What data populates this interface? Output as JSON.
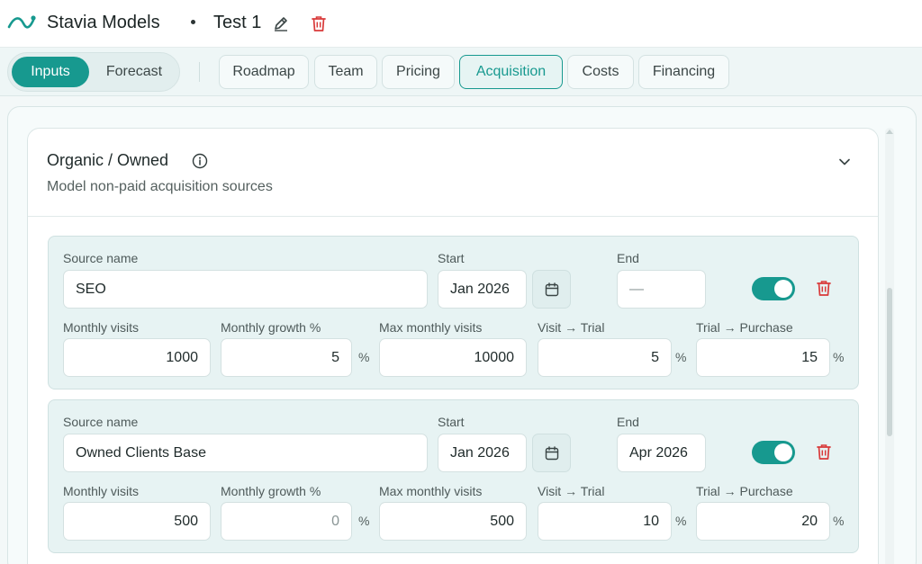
{
  "header": {
    "app_title": "Stavia Models",
    "model_name": "Test 1",
    "icons": [
      "logo-wave-icon",
      "pencil-icon",
      "trash-icon"
    ],
    "accent_color": "#17998f",
    "danger_color": "#d93a3a"
  },
  "mode_toggle": {
    "inputs": "Inputs",
    "forecast": "Forecast",
    "selected": "Inputs"
  },
  "tabs": {
    "roadmap": "Roadmap",
    "team": "Team",
    "pricing": "Pricing",
    "acquisition": "Acquisition",
    "costs": "Costs",
    "financing": "Financing",
    "active": "Acquisition"
  },
  "section": {
    "title": "Organic / Owned",
    "subtitle": "Model non-paid acquisition sources",
    "icons": [
      "info-icon",
      "chevron-down-icon"
    ]
  },
  "labels": {
    "source_name": "Source name",
    "start": "Start",
    "end": "End",
    "monthly_visits": "Monthly visits",
    "monthly_growth": "Monthly growth %",
    "max_monthly_visits": "Max monthly visits",
    "visit_trial": "Visit → Trial",
    "trial_purchase": "Trial → Purchase",
    "percent": "%"
  },
  "sources": [
    {
      "name": "SEO",
      "start": "Jan 2026",
      "end": "—",
      "enabled": true,
      "monthly_visits": "1000",
      "monthly_growth": "5",
      "max_monthly_visits": "10000",
      "visit_trial": "5",
      "trial_purchase": "15"
    },
    {
      "name": "Owned Clients Base",
      "start": "Jan 2026",
      "end": "Apr 2026",
      "enabled": true,
      "monthly_visits": "500",
      "monthly_growth": "0",
      "max_monthly_visits": "500",
      "visit_trial": "10",
      "trial_purchase": "20"
    }
  ]
}
